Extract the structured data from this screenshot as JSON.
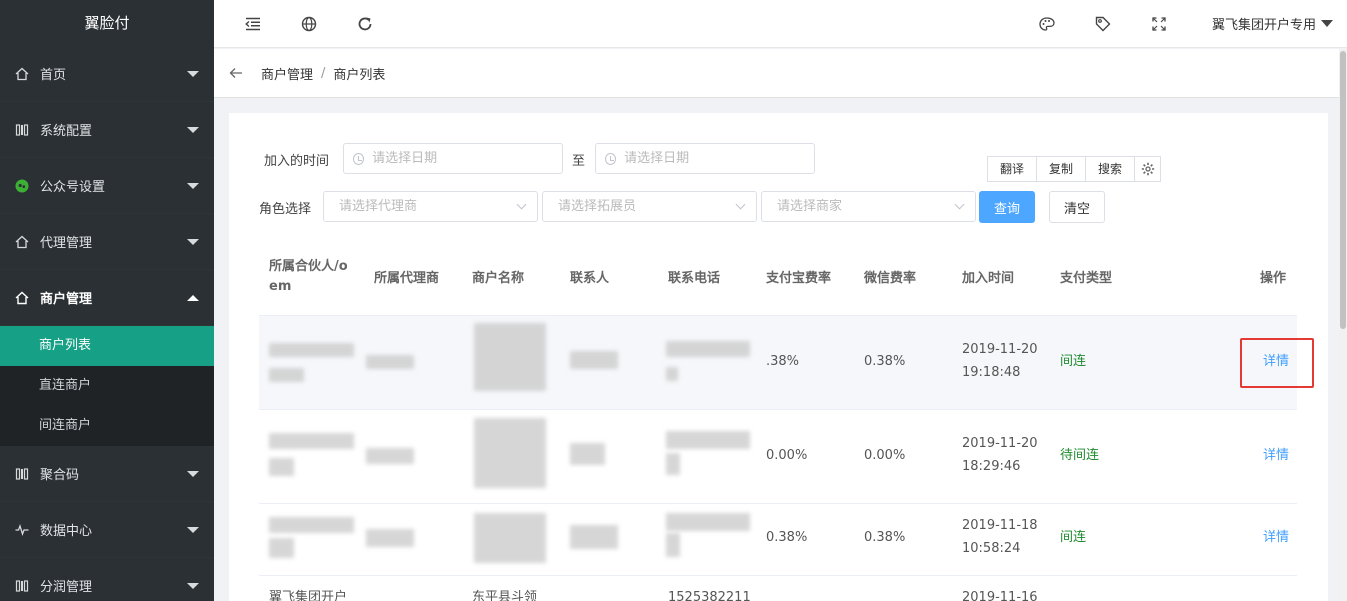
{
  "app": {
    "brand": "翼脸付"
  },
  "sidebar": {
    "items": [
      {
        "label": "首页",
        "icon": "home-icon",
        "open": false
      },
      {
        "label": "系统配置",
        "icon": "config-icon",
        "open": false
      },
      {
        "label": "公众号设置",
        "icon": "wechat-icon",
        "open": false
      },
      {
        "label": "代理管理",
        "icon": "home-icon",
        "open": false
      },
      {
        "label": "商户管理",
        "icon": "home-icon",
        "open": true
      },
      {
        "label": "聚合码",
        "icon": "config-icon",
        "open": false
      },
      {
        "label": "数据中心",
        "icon": "pulse-icon",
        "open": false
      },
      {
        "label": "分润管理",
        "icon": "config-icon",
        "open": false
      }
    ],
    "submenu": [
      {
        "label": "商户列表",
        "active": true
      },
      {
        "label": "直连商户",
        "active": false
      },
      {
        "label": "间连商户",
        "active": false
      }
    ]
  },
  "topbar": {
    "user": "翼飞集团开户专用",
    "icons": [
      "indent-icon",
      "globe-icon",
      "refresh-icon",
      "palette-icon",
      "tag-icon",
      "fullscreen-icon"
    ]
  },
  "breadcrumb": {
    "parent": "商户管理",
    "sep": "/",
    "current": "商户列表"
  },
  "filters": {
    "join_time_label": "加入的时间",
    "date_placeholder": "请选择日期",
    "to_label": "至",
    "role_label": "角色选择",
    "agent_placeholder": "请选择代理商",
    "promoter_placeholder": "请选择拓展员",
    "merchant_placeholder": "请选择商家",
    "query_button": "查询",
    "clear_button": "清空"
  },
  "tools": {
    "translate": "翻译",
    "copy": "复制",
    "search": "搜索"
  },
  "table": {
    "headers": {
      "partner_line1": "所属合伙人/o",
      "partner_line2": "em",
      "agent": "所属代理商",
      "merchant": "商户名称",
      "contact": "联系人",
      "phone": "联系电话",
      "alipay_rate": "支付宝费率",
      "wechat_rate": "微信费率",
      "join_time": "加入时间",
      "pay_type": "支付类型",
      "action": "操作"
    },
    "rows": [
      {
        "alipay": ".38%",
        "wechat": "0.38%",
        "date": "2019-11-20",
        "time": "19:18:48",
        "pay_type": "间连",
        "action": "详情"
      },
      {
        "alipay": "0.00%",
        "wechat": "0.00%",
        "date": "2019-11-20",
        "time": "18:29:46",
        "pay_type": "待间连",
        "action": "详情"
      },
      {
        "alipay": "0.38%",
        "wechat": "0.38%",
        "date": "2019-11-18",
        "time": "10:58:24",
        "pay_type": "间连",
        "action": "详情"
      },
      {
        "partner": "翼飞集团开户",
        "merchant": "东平县斗领",
        "phone": "1525382211",
        "date": "2019-11-16"
      }
    ]
  },
  "colors": {
    "sidebar_bg": "#2b3034",
    "active_green": "#16a085",
    "primary_blue": "#4da6ff",
    "status_green": "#1f8a2e",
    "highlight_red": "#e53935"
  }
}
